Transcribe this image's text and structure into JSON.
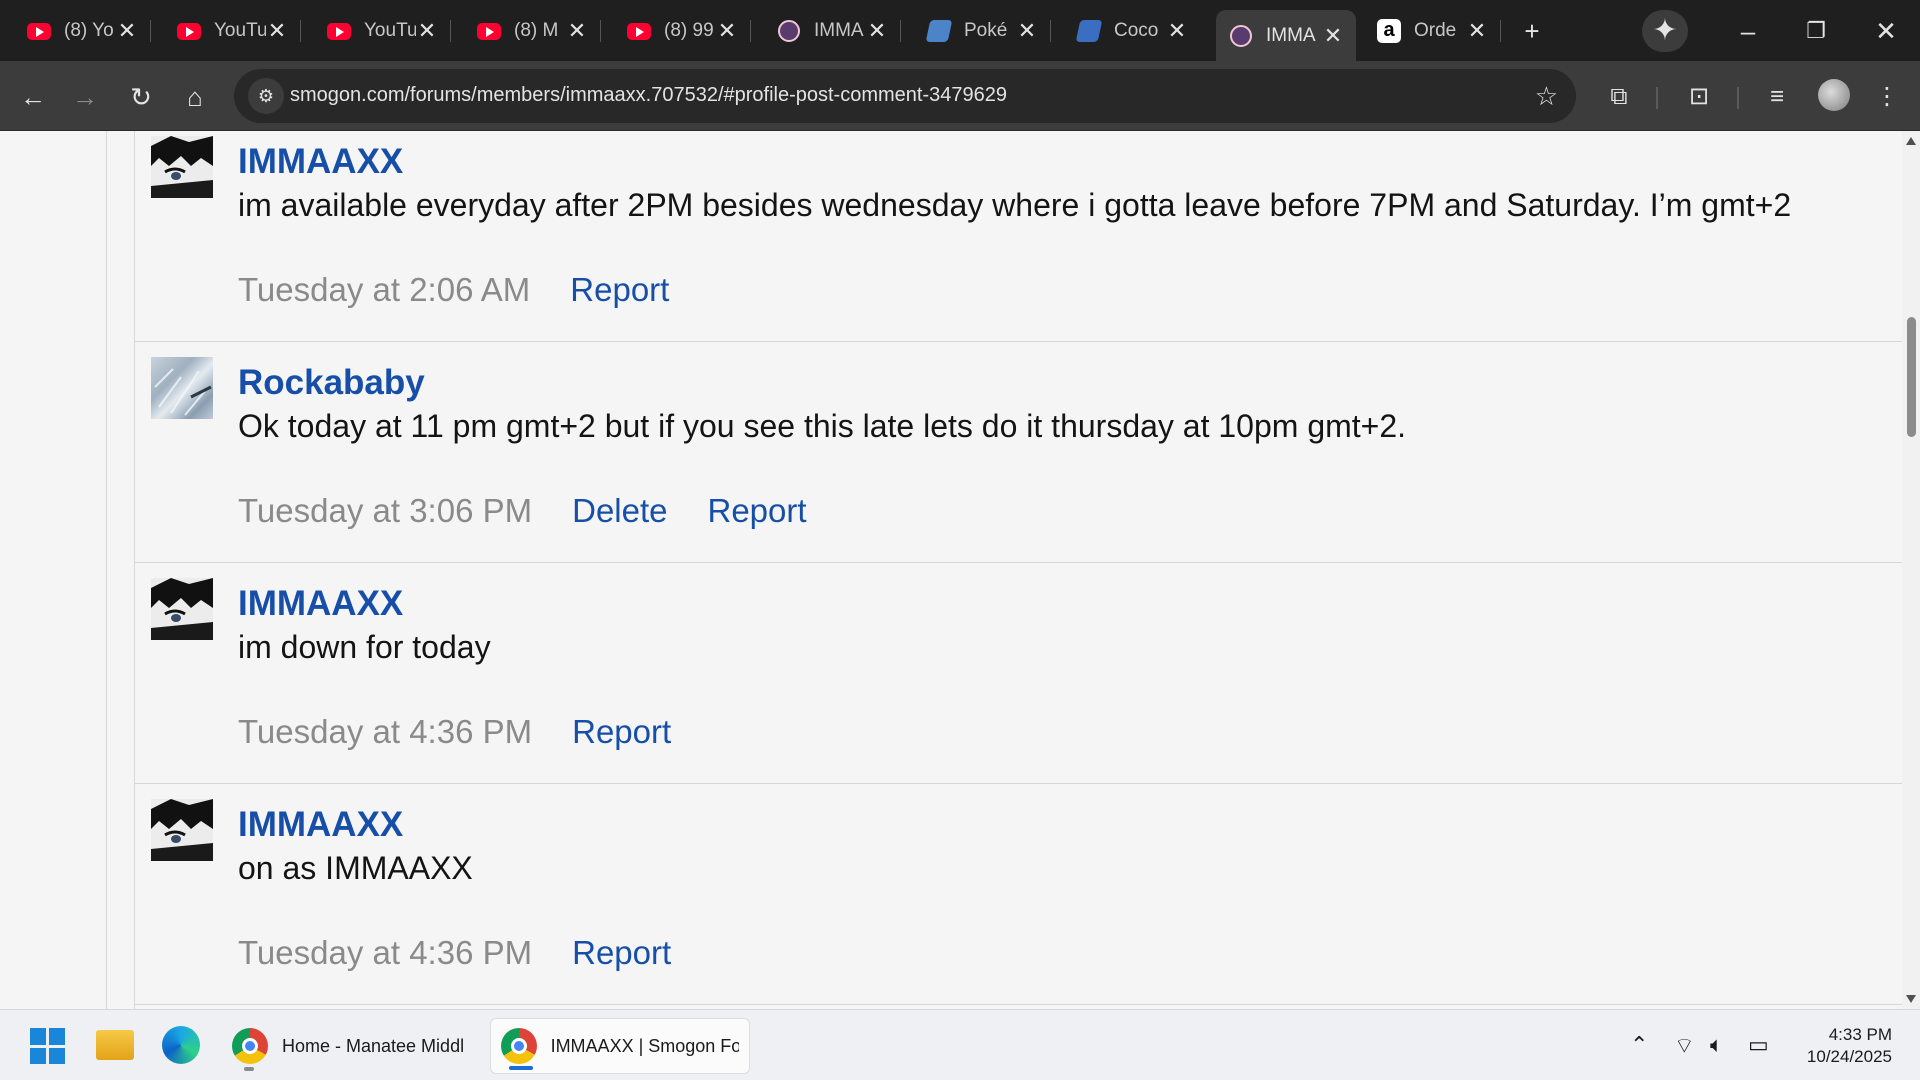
{
  "browser": {
    "tabs": [
      {
        "favicon": "youtube-icon",
        "title": "(8) Yo"
      },
      {
        "favicon": "youtube-icon",
        "title": "YouTu"
      },
      {
        "favicon": "youtube-icon",
        "title": "YouTu"
      },
      {
        "favicon": "youtube-icon",
        "title": "(8) M"
      },
      {
        "favicon": "youtube-icon",
        "title": "(8) 99"
      },
      {
        "favicon": "smogon-icon",
        "title": "IMMA"
      },
      {
        "favicon": "pokemon-icon",
        "title": "Poké"
      },
      {
        "favicon": "coco-icon",
        "title": "Coco"
      },
      {
        "favicon": "smogon-icon",
        "title": "IMMA",
        "active": true
      },
      {
        "favicon": "amazon-icon",
        "title": "Orde"
      }
    ],
    "new_tab_glyph": "+",
    "close_glyph": "✕",
    "url": "smogon.com/forums/members/immaaxx.707532/#profile-post-comment-3479629"
  },
  "comments": [
    {
      "username": "IMMAAXX",
      "avatar": "manga-avatar",
      "message": "im available everyday after 2PM besides wednesday where i gotta leave before 7PM and Saturday. I’m gmt+2",
      "time": "Tuesday at 2:06 AM",
      "actions": [
        "Report"
      ]
    },
    {
      "username": "Rockababy",
      "avatar": "frost-avatar",
      "message": "Ok today at 11 pm gmt+2 but if you see this late lets do it thursday at 10pm gmt+2.",
      "time": "Tuesday at 3:06 PM",
      "actions": [
        "Delete",
        "Report"
      ]
    },
    {
      "username": "IMMAAXX",
      "avatar": "manga-avatar",
      "message": "im down for today",
      "time": "Tuesday at 4:36 PM",
      "actions": [
        "Report"
      ]
    },
    {
      "username": "IMMAAXX",
      "avatar": "manga-avatar",
      "message": "on as IMMAAXX",
      "time": "Tuesday at 4:36 PM",
      "actions": [
        "Report"
      ]
    }
  ],
  "taskbar": {
    "apps": [
      {
        "label": "Home - Manatee Middl"
      },
      {
        "label": "IMMAAXX | Smogon Fo",
        "active": true
      }
    ],
    "time": "4:33 PM",
    "date": "10/24/2025"
  },
  "colors": {
    "link": "#174fa8",
    "muted": "#8a8a8a",
    "chrome_dark": "#1f1f1f",
    "toolbar": "#3c3c3c"
  }
}
